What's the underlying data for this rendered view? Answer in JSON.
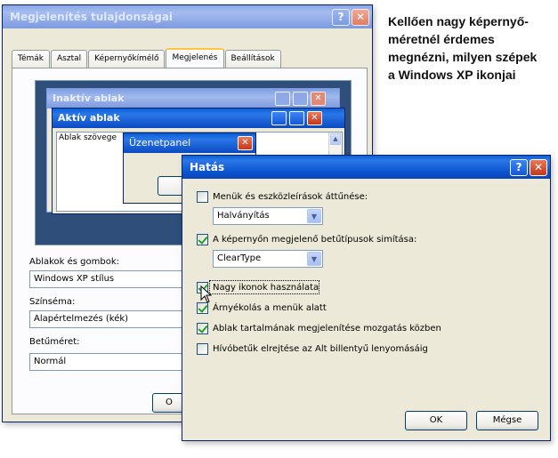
{
  "caption": {
    "lines": [
      "Kellően nagy képernyő-",
      "méretnél érdemes",
      "megnézni, milyen szépek",
      "a Windows XP ikonjai"
    ]
  },
  "back_dialog": {
    "title": "Megjelenítés tulajdonságai",
    "help_label": "?",
    "close_label": "✕",
    "tabs": [
      {
        "label": "Témák"
      },
      {
        "label": "Asztal"
      },
      {
        "label": "Képernyőkímélő"
      },
      {
        "label": "Megjelenés",
        "active": true
      },
      {
        "label": "Beállítások"
      }
    ],
    "preview": {
      "inactive_title": "Inaktív ablak",
      "active_title": "Aktív ablak",
      "window_text": "Ablak szövege",
      "message_title": "Üzenetpanel"
    },
    "windows_buttons": {
      "label": "Ablakok és gombok:",
      "value": "Windows XP stílus"
    },
    "color_scheme": {
      "label": "Színséma:",
      "value": "Alapértelmezés (kék)"
    },
    "font_size": {
      "label": "Betűméret:",
      "value": "Normál"
    },
    "ok_partial": "O"
  },
  "effects_dialog": {
    "title": "Hatás",
    "help_label": "?",
    "close_label": "✕",
    "options": [
      {
        "label": "Menük és eszközleírások áttűnése:",
        "checked": false
      },
      {
        "label": "A képernyőn megjelenő betűtípusok simítása:",
        "checked": true
      },
      {
        "label": "Nagy ikonok használata",
        "checked": true
      },
      {
        "label": "Árnyékolás a menük alatt",
        "checked": true
      },
      {
        "label": "Ablak tartalmának megjelenítése mozgatás közben",
        "checked": true
      },
      {
        "label": "Hívóbetűk elrejtése az Alt billentyű lenyomásáig",
        "checked": false
      }
    ],
    "transition_select": {
      "value": "Halványítás"
    },
    "smoothing_select": {
      "value": "ClearType"
    },
    "ok_label": "OK",
    "cancel_label": "Mégse"
  },
  "colors": {
    "xp_blue": "#0a5fd8",
    "close_red": "#c5371a",
    "dialog_face": "#ece9d8",
    "preview_desktop": "#2f4e7a"
  }
}
